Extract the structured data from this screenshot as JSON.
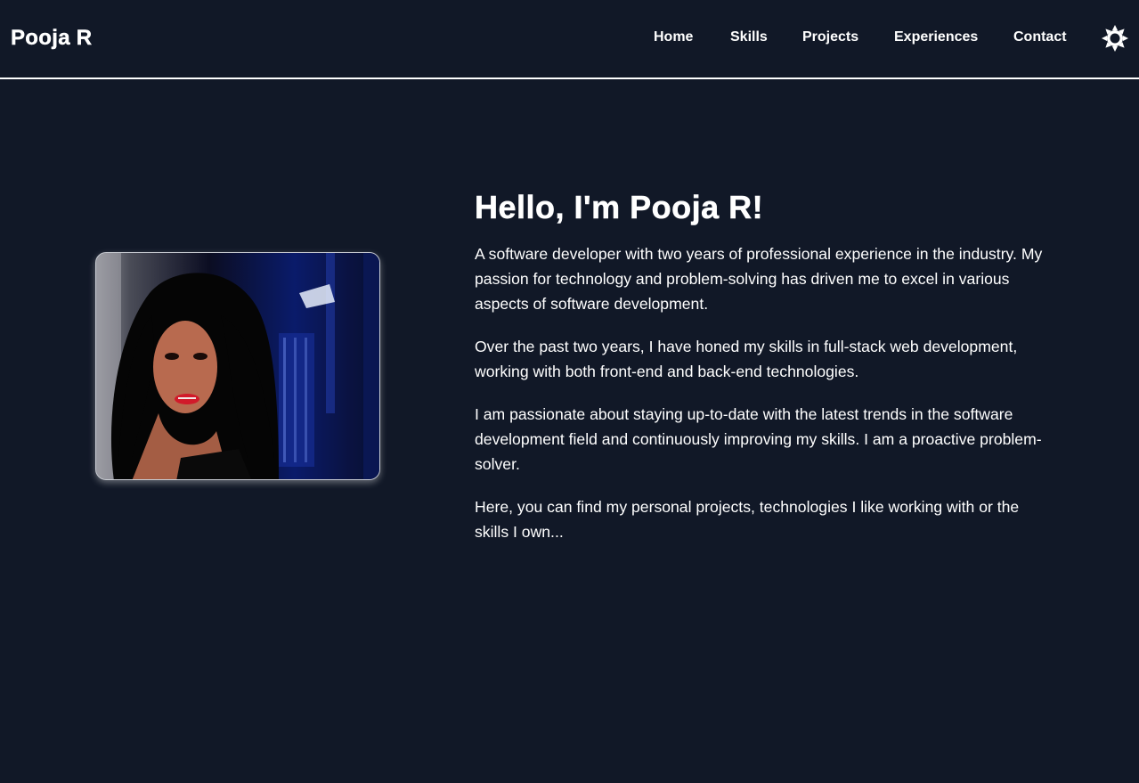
{
  "nav": {
    "brand": "Pooja R",
    "links": [
      "Home",
      "Skills",
      "Projects",
      "Experiences",
      "Contact"
    ],
    "theme_toggle_icon": "sun-icon"
  },
  "hero": {
    "photo_icon": "profile-photo",
    "heading": "Hello, I'm Pooja R!",
    "paragraphs": [
      "A software developer with two years of professional experience in the industry. My passion for technology and problem-solving has driven me to excel in various aspects of software development.",
      "Over the past two years, I have honed my skills in full-stack web development, working with both front-end and back-end technologies.",
      "I am passionate about staying up-to-date with the latest trends in the software development field and continuously improving my skills. I am a proactive problem-solver.",
      "Here, you can find my personal projects, technologies I like working with or the skills I own..."
    ]
  },
  "colors": {
    "background": "#111827",
    "text": "#ffffff",
    "divider": "#ffffff"
  }
}
